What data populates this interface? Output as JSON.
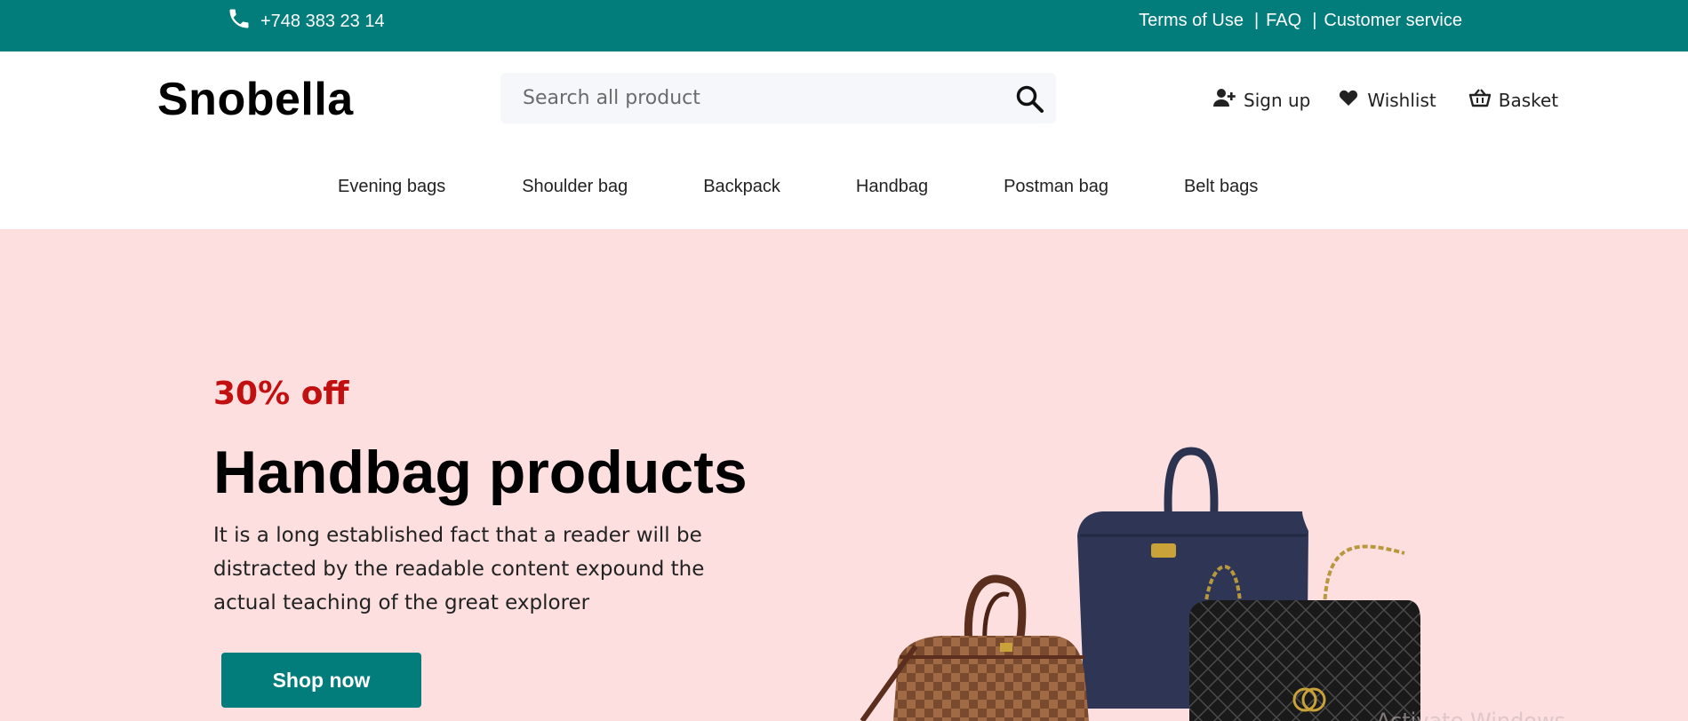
{
  "topbar": {
    "phone": "+748 383 23 14",
    "links": [
      "Terms of Use",
      "FAQ",
      "Customer service"
    ],
    "separator": "|",
    "icon": "phone-icon",
    "bg_color": "#037c7c"
  },
  "header": {
    "logo": "Snobella",
    "search_placeholder": "Search all product",
    "search_icon": "search-icon",
    "actions": {
      "signup": "Sign up",
      "wishlist": "Wishlist",
      "basket": "Basket"
    },
    "action_icons": [
      "user-plus-icon",
      "heart-icon",
      "basket-icon"
    ]
  },
  "nav": [
    "Evening bags",
    "Shoulder bag",
    "Backpack",
    "Handbag",
    "Postman bag",
    "Belt bags"
  ],
  "hero": {
    "discount": "30% off",
    "title": "Handbag products",
    "description": "It is a long established fact that a reader will be distracted by the readable content expound the actual teaching of the great explorer",
    "button": "Shop now",
    "bg_color": "#fddfe0",
    "accent_color": "#c21010",
    "image": "handbags-image"
  },
  "watermark": "Activate Windows"
}
